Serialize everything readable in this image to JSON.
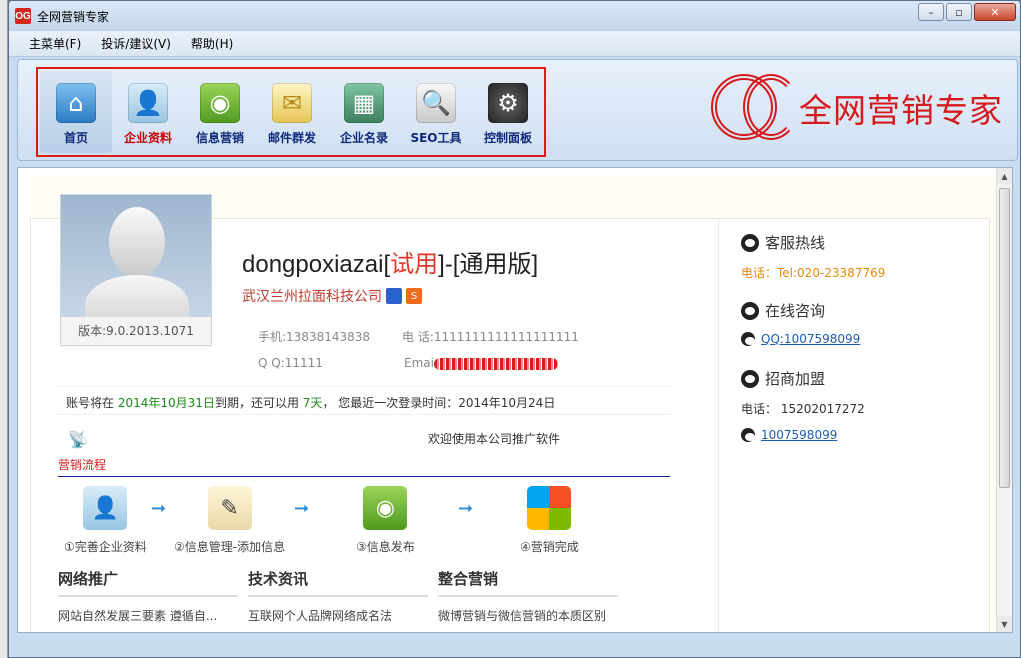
{
  "window": {
    "title": "全网营销专家",
    "app_icon_text": "OG",
    "controls": {
      "minimize": "–",
      "maximize": "▫",
      "close": "✕"
    }
  },
  "menu": [
    "主菜单(F)",
    "投诉/建议(V)",
    "帮助(H)"
  ],
  "toolbar": [
    {
      "label": "首页",
      "icon": "home-icon",
      "active": true
    },
    {
      "label": "企业资料",
      "icon": "user-profile-icon",
      "red": true
    },
    {
      "label": "信息营销",
      "icon": "rss-icon"
    },
    {
      "label": "邮件群发",
      "icon": "mail-icon"
    },
    {
      "label": "企业名录",
      "icon": "directory-icon"
    },
    {
      "label": "SEO工具",
      "icon": "magnifier-icon"
    },
    {
      "label": "控制面板",
      "icon": "gear-icon"
    }
  ],
  "logo": {
    "text": "全网营销专家"
  },
  "profile": {
    "version": "版本:9.0.2013.1071",
    "username": "dongpoxiazai",
    "trial_open": "[",
    "trial": "试用",
    "trial_close": "]",
    "edition": "-[通用版]",
    "company": "武汉兰州拉面科技公司",
    "mobile": "手机:13838143838",
    "phone_label": "电   话:",
    "phone_value": "1111111111111111111",
    "qq": "Q  Q:11111",
    "email_label": "Emai"
  },
  "account": {
    "pre": "账号将在",
    "expire_date": "2014年10月31日",
    "mid": "到期，还可以用",
    "days": "7天",
    "post": "，  您最近一次登录时间：2014年10月24日"
  },
  "welcome": "欢迎使用本公司推广软件",
  "flow": {
    "title": "营销流程",
    "steps": [
      {
        "label": "①完善企业资料",
        "icon": "company-profile-icon"
      },
      {
        "label": "②信息管理-添加信息",
        "icon": "notepad-icon"
      },
      {
        "label": "③信息发布",
        "icon": "rss-icon"
      },
      {
        "label": "④营销完成",
        "icon": "windows-flag-icon"
      }
    ],
    "arrow": "➞"
  },
  "news": [
    {
      "heading": "网络推广",
      "items": [
        "网站自然发展三要素 遵循自..."
      ]
    },
    {
      "heading": "技术资讯",
      "items": [
        "互联网个人品牌网络成名法"
      ]
    },
    {
      "heading": "整合营销",
      "items": [
        "微博营销与微信营销的本质区别"
      ]
    }
  ],
  "side": {
    "hotline_head": "客服热线",
    "hotline": "电话：Tel:020-23387769",
    "consult_head": "在线咨询",
    "consult_qq": "QQ:1007598099",
    "join_head": "招商加盟",
    "join_phone": "电话：  15202017272",
    "join_qq": "1007598099"
  },
  "colors": {
    "accent_red": "#d6191c",
    "link_blue": "#1e5bb5",
    "nav_blue": "#0f2a7a"
  }
}
